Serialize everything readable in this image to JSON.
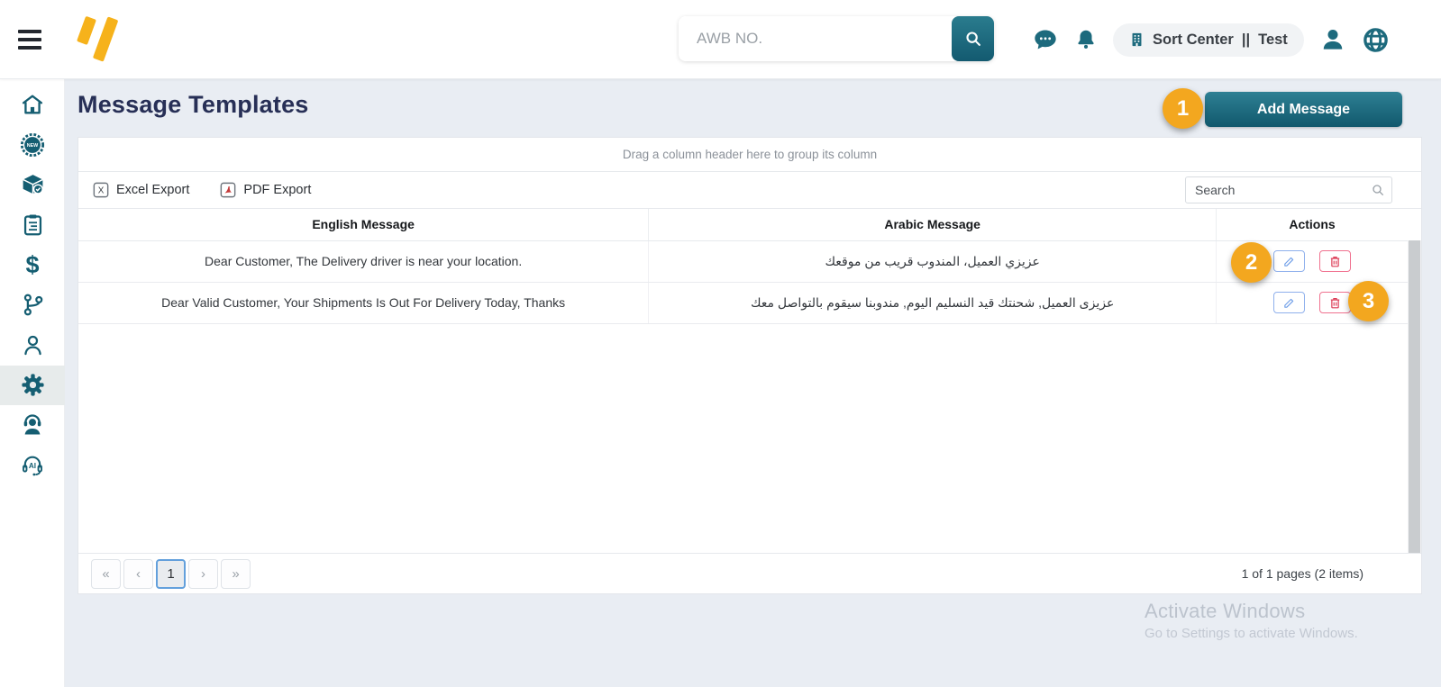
{
  "header": {
    "search_placeholder": "AWB NO.",
    "station": {
      "name": "Sort Center",
      "separator": "||",
      "env": "Test"
    }
  },
  "page": {
    "title": "Message Templates",
    "add_button_label": "Add Message"
  },
  "grid": {
    "group_hint": "Drag a column header here to group its column",
    "toolbar": {
      "excel_label": "Excel Export",
      "pdf_label": "PDF Export",
      "search_placeholder": "Search"
    },
    "columns": {
      "english": "English Message",
      "arabic": "Arabic Message",
      "actions": "Actions"
    },
    "rows": [
      {
        "english": "Dear Customer, The Delivery driver is near your location.",
        "arabic": "عزيزي العميل، المندوب قريب من موقعك"
      },
      {
        "english": "Dear Valid Customer, Your Shipments Is Out For Delivery Today, Thanks",
        "arabic": "عزيزى العميل, شحنتك قيد النسليم اليوم, مندوبنا سيقوم بالتواصل معك"
      }
    ],
    "pagination": {
      "first": "«",
      "prev": "‹",
      "current_page": "1",
      "next": "›",
      "last": "»",
      "summary": "1 of 1 pages (2 items)"
    }
  },
  "annotations": {
    "step1": "1",
    "step2": "2",
    "step3": "3"
  },
  "watermark": {
    "title": "Activate Windows",
    "subtitle": "Go to Settings to activate Windows."
  },
  "icons": {
    "dollar_glyph": "$",
    "excel_glyph": "X",
    "ai_glyph": "AI",
    "new_glyph": "NEW"
  },
  "colors": {
    "teal": "#1A6B7D",
    "button_teal_gradient_top": "#2E8094",
    "button_teal_gradient_bottom": "#11586D",
    "accent_orange": "#F3A71F",
    "title_navy": "#272F56",
    "edit_blue": "#6E9EE8",
    "delete_red": "#E24258",
    "logo_yellow": "#F6B21B"
  }
}
